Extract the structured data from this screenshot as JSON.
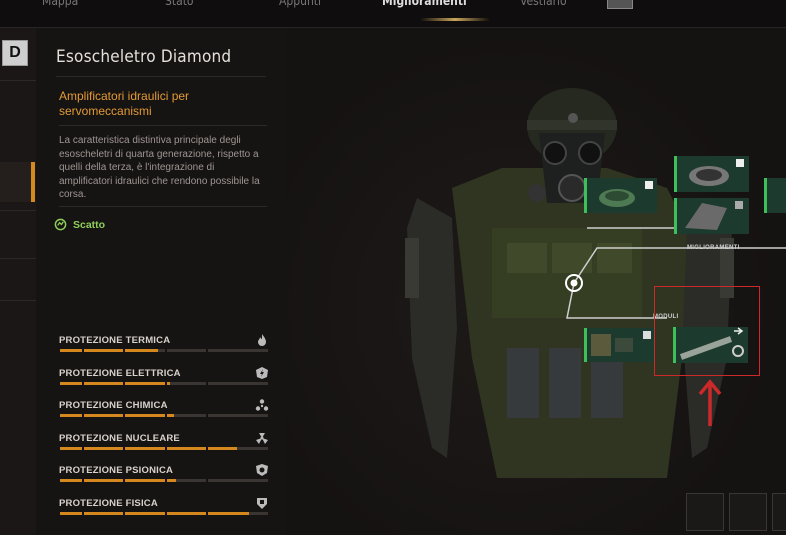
{
  "tabs": [
    "Mappa",
    "Stato",
    "Appunti",
    "Miglioramenti",
    "Vestiario"
  ],
  "active_tab": "Miglioramenti",
  "item": {
    "badge": "D",
    "title": "Esoscheletro Diamond",
    "subtitle": "Amplificatori idraulici per servomeccanismi",
    "description": "La caratteristica distintiva principale degli esoscheletri di quarta generazione, rispetto a quelli della terza, è l'integrazione di amplificatori idraulici che rendono possibile la corsa.",
    "skill": "Scatto"
  },
  "protections": [
    {
      "label": "PROTEZIONE TERMICA",
      "icon": "flame-icon",
      "value": 0.47
    },
    {
      "label": "PROTEZIONE ELETTRICA",
      "icon": "lightning-icon",
      "value": 0.53
    },
    {
      "label": "PROTEZIONE CHIMICA",
      "icon": "chemical-icon",
      "value": 0.55
    },
    {
      "label": "PROTEZIONE NUCLEARE",
      "icon": "radiation-icon",
      "value": 0.85
    },
    {
      "label": "PROTEZIONE PSIONICA",
      "icon": "psi-icon",
      "value": 0.56
    },
    {
      "label": "PROTEZIONE FISICA",
      "icon": "shield-icon",
      "value": 0.91
    }
  ],
  "scene": {
    "upgrades_label": "MIGLIORAMENTI",
    "modules_label": "MODULI"
  },
  "colors": {
    "accent": "#d4881e",
    "green": "#3fbf5a",
    "highlight": "#cc2a2a"
  }
}
